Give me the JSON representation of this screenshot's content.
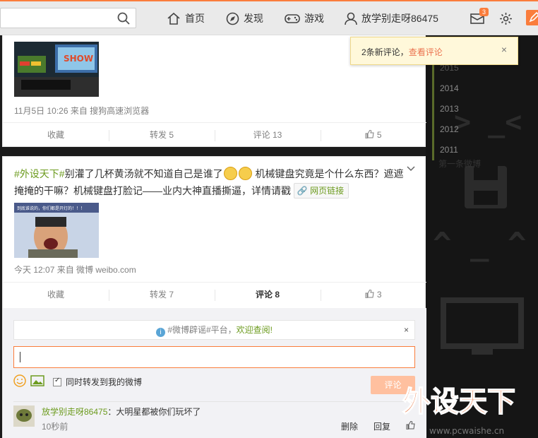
{
  "nav": {
    "home": "首页",
    "discover": "发现",
    "game": "游戏",
    "user": "放学别走呀86475",
    "message_count": "3"
  },
  "notify": {
    "text": "2条新评论，",
    "link": "查看评论",
    "close": "×"
  },
  "timeline": {
    "years": [
      "2015",
      "2014",
      "2013",
      "2012",
      "2011"
    ],
    "first": "第一条微博"
  },
  "card1": {
    "thumb_text": "SHOW",
    "meta": "11月5日 10:26 来自 搜狗高速浏览器",
    "actions": {
      "collect": "收藏",
      "repost": "转发 5",
      "comment": "评论 13",
      "like": "5"
    }
  },
  "card2": {
    "hashtag": "#外设天下#",
    "text_a": "别灌了几杯黄汤就不知道自己是谁了",
    "text_b": "机械键盘究竟是个什么东西？遮遮掩掩的干嘛？机械键盘打脸记——业内大神直播撕逼，详情请戳",
    "weblink": "网页链接",
    "thumb_caption": "到底谁说的，你们都是开灯的！！！",
    "meta": "今天 12:07 来自 微博 weibo.com",
    "actions": {
      "collect": "收藏",
      "repost": "转发 7",
      "comment": "评论 8",
      "like": "3"
    }
  },
  "comments": {
    "tip_prefix": "#微博辟谣#平台，",
    "tip_link": "欢迎查阅!",
    "tip_close": "×",
    "repost_label": "同时转发到我的微博",
    "send": "评论",
    "item": {
      "user": "放学别走呀86475",
      "text": "：大明星都被你们玩坏了",
      "time": "10秒前",
      "delete": "删除",
      "reply": "回复"
    }
  },
  "watermark": {
    "brand": "外设天下",
    "url": "www.pcwaishe.cn"
  }
}
